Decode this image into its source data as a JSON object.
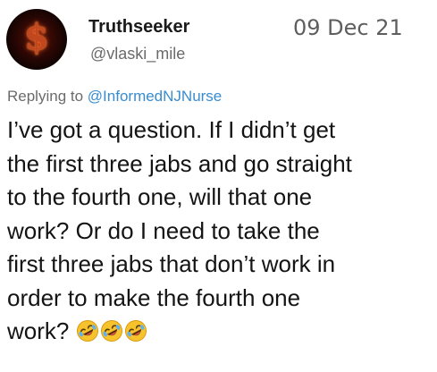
{
  "author": {
    "name": "Truthseeker",
    "handle": "@vlaski_mile",
    "avatar_glyph": "$"
  },
  "date": "09 Dec 21",
  "reply": {
    "prefix": "Replying to",
    "mention": "@InformedNJNurse"
  },
  "body": {
    "lines": [
      "I’ve got a question. If I didn’t get",
      "the first three jabs and go straight",
      "to the fourth one, will that one",
      "work? Or do I need to take the",
      "first three jabs that don’t work in",
      "order to make the fourth one",
      "work?"
    ],
    "emojis": [
      "rolling-on-floor-laughing",
      "rolling-on-floor-laughing",
      "rolling-on-floor-laughing"
    ]
  },
  "colors": {
    "mention": "#3a8ccf",
    "secondary_text": "#6b6b6b",
    "emoji_face": "#f6c32c"
  }
}
